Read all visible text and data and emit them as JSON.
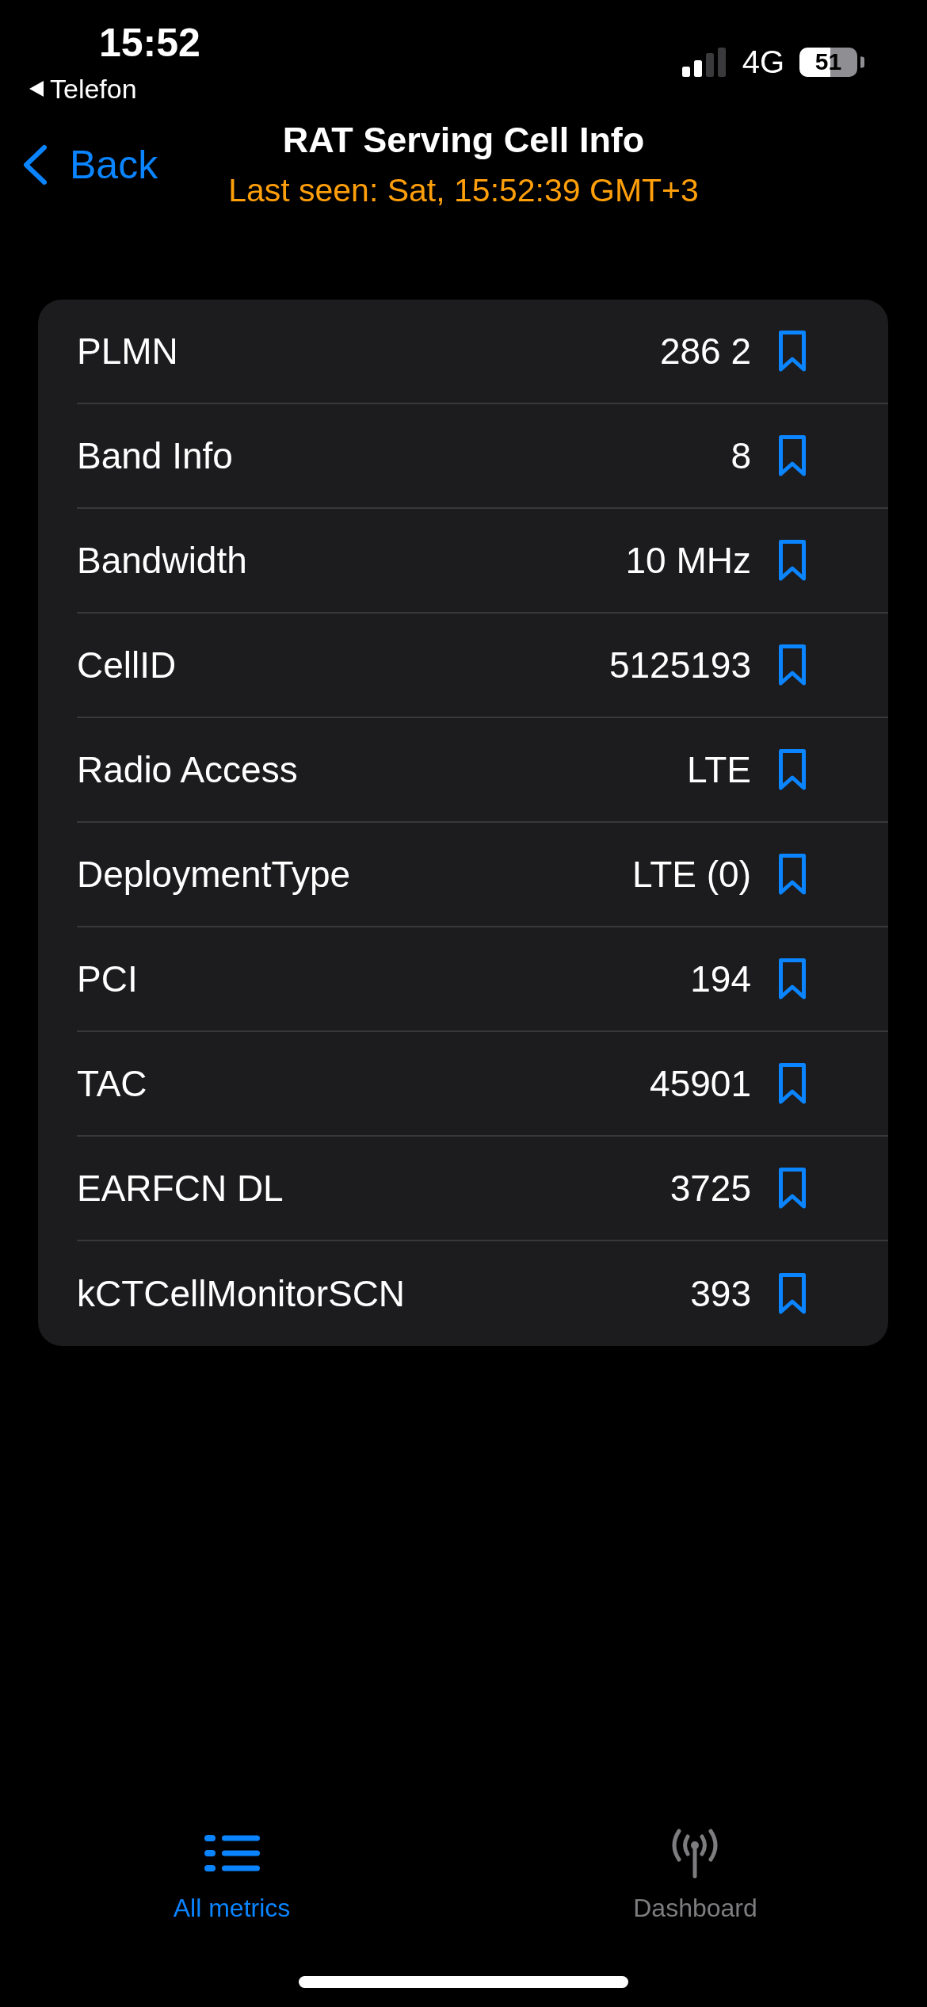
{
  "status_bar": {
    "time": "15:52",
    "back_to_app": "Telefon",
    "network": "4G",
    "battery": "51"
  },
  "nav": {
    "back": "Back",
    "title": "RAT Serving Cell Info",
    "subtitle": "Last seen: Sat, 15:52:39 GMT+3"
  },
  "rows": [
    {
      "label": "PLMN",
      "value": "286 2",
      "bookmarked": false
    },
    {
      "label": "Band Info",
      "value": "8",
      "bookmarked": false
    },
    {
      "label": "Bandwidth",
      "value": "10 MHz",
      "bookmarked": false
    },
    {
      "label": "CellID",
      "value": "5125193",
      "bookmarked": false
    },
    {
      "label": "Radio Access",
      "value": "LTE",
      "bookmarked": false
    },
    {
      "label": "DeploymentType",
      "value": "LTE (0)",
      "bookmarked": false
    },
    {
      "label": "PCI",
      "value": "194",
      "bookmarked": false
    },
    {
      "label": "TAC",
      "value": "45901",
      "bookmarked": false
    },
    {
      "label": "EARFCN DL",
      "value": "3725",
      "bookmarked": false
    },
    {
      "label": "kCTCellMonitorSCN",
      "value": "393",
      "bookmarked": false
    }
  ],
  "tab_bar": [
    {
      "label": "All metrics",
      "selected": true
    },
    {
      "label": "Dashboard",
      "selected": false
    }
  ]
}
